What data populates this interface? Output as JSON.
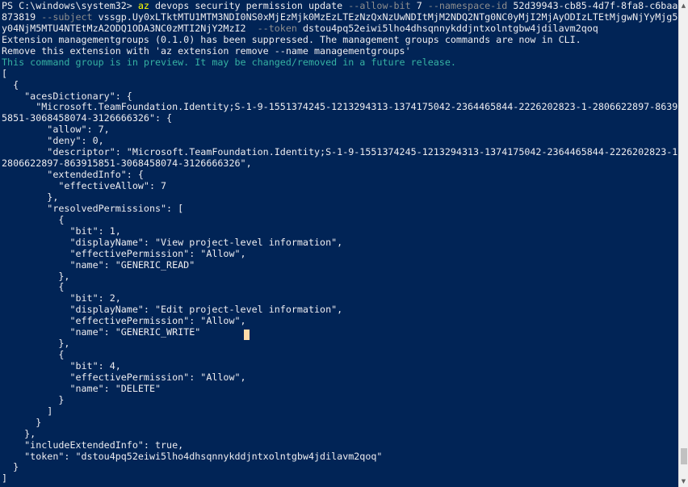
{
  "terminal": {
    "prompt": "PS C:\\windows\\system32> ",
    "command": {
      "name": "az",
      "rest1": " devops security permission update ",
      "p_allow": "--allow-bit",
      "v_allow": " 7 ",
      "p_ns": "--namespace-id",
      "v_ns": " 52d39943-cb85-4d7f-8fa8-c6baac",
      "wrap_value": "873819 ",
      "p_subject": "--subject",
      "v_subject": " vssgp.Uy0xLTktMTU1MTM3NDI0NS0xMjEzMjk0MzEzLTEzNzQxNzUwNDItMjM2NDQ2NTg0NC0yMjI2MjAyODIzLTEtMjgwNjYyMjg5N",
      "wrap_subject": "y04NjM5MTU4NTEtMzA2ODQ1ODA3NC0zMTI2NjY2MzI2 ",
      "p_token": " --token",
      "v_token": " dstou4pq52eiwi5lho4dhsqnnykddjntxolntgbw4jdilavm2qoq"
    },
    "messages": {
      "suppressed": "Extension managementgroups (0.1.0) has been suppressed. The management groups commands are now in CLI.",
      "remove": "Remove this extension with 'az extension remove --name managementgroups'",
      "preview": "This command group is in preview. It may be changed/removed in a future release."
    },
    "json_lines": [
      "[",
      "  {",
      "    \"acesDictionary\": {",
      "      \"Microsoft.TeamFoundation.Identity;S-1-9-1551374245-1213294313-1374175042-2364465844-2226202823-1-2806622897-86391",
      "5851-3068458074-3126666326\": {",
      "        \"allow\": 7,",
      "        \"deny\": 0,",
      "        \"descriptor\": \"Microsoft.TeamFoundation.Identity;S-1-9-1551374245-1213294313-1374175042-2364465844-2226202823-1-",
      "2806622897-863915851-3068458074-3126666326\",",
      "        \"extendedInfo\": {",
      "          \"effectiveAllow\": 7",
      "        },",
      "        \"resolvedPermissions\": [",
      "          {",
      "            \"bit\": 1,",
      "            \"displayName\": \"View project-level information\",",
      "            \"effectivePermission\": \"Allow\",",
      "            \"name\": \"GENERIC_READ\"",
      "          },",
      "          {",
      "            \"bit\": 2,",
      "            \"displayName\": \"Edit project-level information\",",
      "            \"effectivePermission\": \"Allow\",",
      "            \"name\": \"GENERIC_WRITE\"",
      "          },",
      "          {",
      "            \"bit\": 4,",
      "            \"effectivePermission\": \"Allow\",",
      "            \"name\": \"DELETE\"",
      "          }",
      "        ]",
      "      }",
      "    },",
      "    \"includeExtendedInfo\": true,",
      "    \"token\": \"dstou4pq52eiwi5lho4dhsqnnykddjntxolntgbw4jdilavm2qoq\"",
      "  }",
      "]"
    ]
  },
  "scrollbar": {
    "up_arrow": "▲",
    "down_arrow": "▼"
  },
  "colors": {
    "background": "#012456",
    "text": "#eeedf0",
    "command_name": "#ffff00",
    "parameter": "#8e8e8e",
    "preview_message": "#36b2a3",
    "cursor": "#fedba9"
  },
  "icons": {
    "cursor": "text-cursor-block",
    "scroll_up": "arrow-up-icon",
    "scroll_down": "arrow-down-icon"
  }
}
